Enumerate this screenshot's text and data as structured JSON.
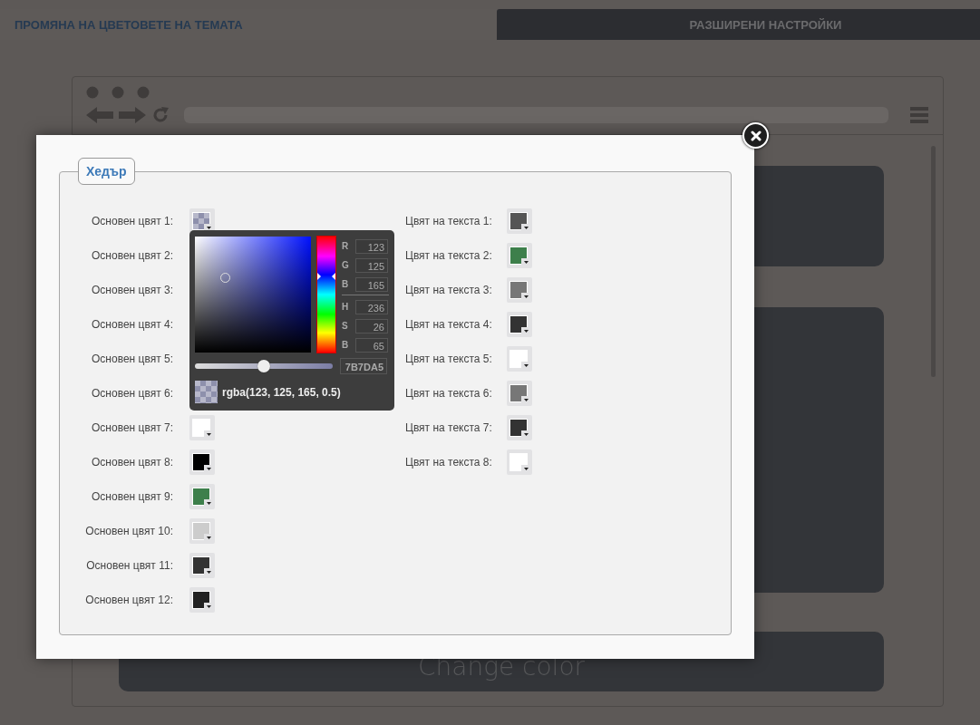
{
  "tabs": [
    {
      "label": "ПРОМЯНА НА ЦВЕТОВЕТЕ НА ТЕМАТА",
      "selected": true
    },
    {
      "label": "РАЗШИРЕНИ НАСТРОЙКИ",
      "selected": false
    }
  ],
  "preview": {
    "button_label": "Change color"
  },
  "dialog": {
    "legend": "Хедър",
    "main_colors": [
      {
        "label": "Основен цвят 1:",
        "swatch": {
          "kind": "translucent"
        }
      },
      {
        "label": "Основен цвят 2:"
      },
      {
        "label": "Основен цвят 3:"
      },
      {
        "label": "Основен цвят 4:"
      },
      {
        "label": "Основен цвят 5:"
      },
      {
        "label": "Основен цвят 6:"
      },
      {
        "label": "Основен цвят 7:",
        "swatch": {
          "kind": "solid",
          "color": "#ffffff"
        }
      },
      {
        "label": "Основен цвят 8:",
        "swatch": {
          "kind": "solid",
          "color": "#000000"
        }
      },
      {
        "label": "Основен цвят 9:",
        "swatch": {
          "kind": "solid",
          "color": "#3d7f4b"
        }
      },
      {
        "label": "Основен цвят 10:",
        "swatch": {
          "kind": "solid",
          "color": "#cccccc"
        }
      },
      {
        "label": "Основен цвят 11:",
        "swatch": {
          "kind": "solid",
          "color": "#333333"
        }
      },
      {
        "label": "Основен цвят 12:",
        "swatch": {
          "kind": "solid",
          "color": "#222222"
        }
      }
    ],
    "text_colors": [
      {
        "label": "Цвят на текста 1:",
        "swatch": {
          "kind": "solid",
          "color": "#555555"
        }
      },
      {
        "label": "Цвят на текста 2:",
        "swatch": {
          "kind": "solid",
          "color": "#3d7f4b"
        }
      },
      {
        "label": "Цвят на текста 3:",
        "swatch": {
          "kind": "solid",
          "color": "#777777"
        }
      },
      {
        "label": "Цвят на текста 4:",
        "swatch": {
          "kind": "solid",
          "color": "#333333"
        }
      },
      {
        "label": "Цвят на текста 5:",
        "swatch": {
          "kind": "solid",
          "color": "#ffffff"
        }
      },
      {
        "label": "Цвят на текста 6:",
        "swatch": {
          "kind": "solid",
          "color": "#777777"
        }
      },
      {
        "label": "Цвят на текста 7:",
        "swatch": {
          "kind": "solid",
          "color": "#333333"
        }
      },
      {
        "label": "Цвят на текста 8:",
        "swatch": {
          "kind": "solid",
          "color": "#ffffff"
        }
      }
    ],
    "picker": {
      "saturation": {
        "level": 0.26
      },
      "brightness": {
        "level": 0.65
      },
      "hue": {
        "level": 0.656
      },
      "alpha": {
        "level": 0.5
      },
      "fields": [
        {
          "label": "R",
          "value": "123"
        },
        {
          "label": "G",
          "value": "125"
        },
        {
          "label": "B",
          "value": "165"
        },
        {
          "label": "H",
          "value": "236"
        },
        {
          "label": "S",
          "value": "26"
        },
        {
          "label": "B",
          "value": "65"
        }
      ],
      "hex": "7B7DA5",
      "rgba": "rgba(123, 125, 165, 0.5)"
    }
  }
}
